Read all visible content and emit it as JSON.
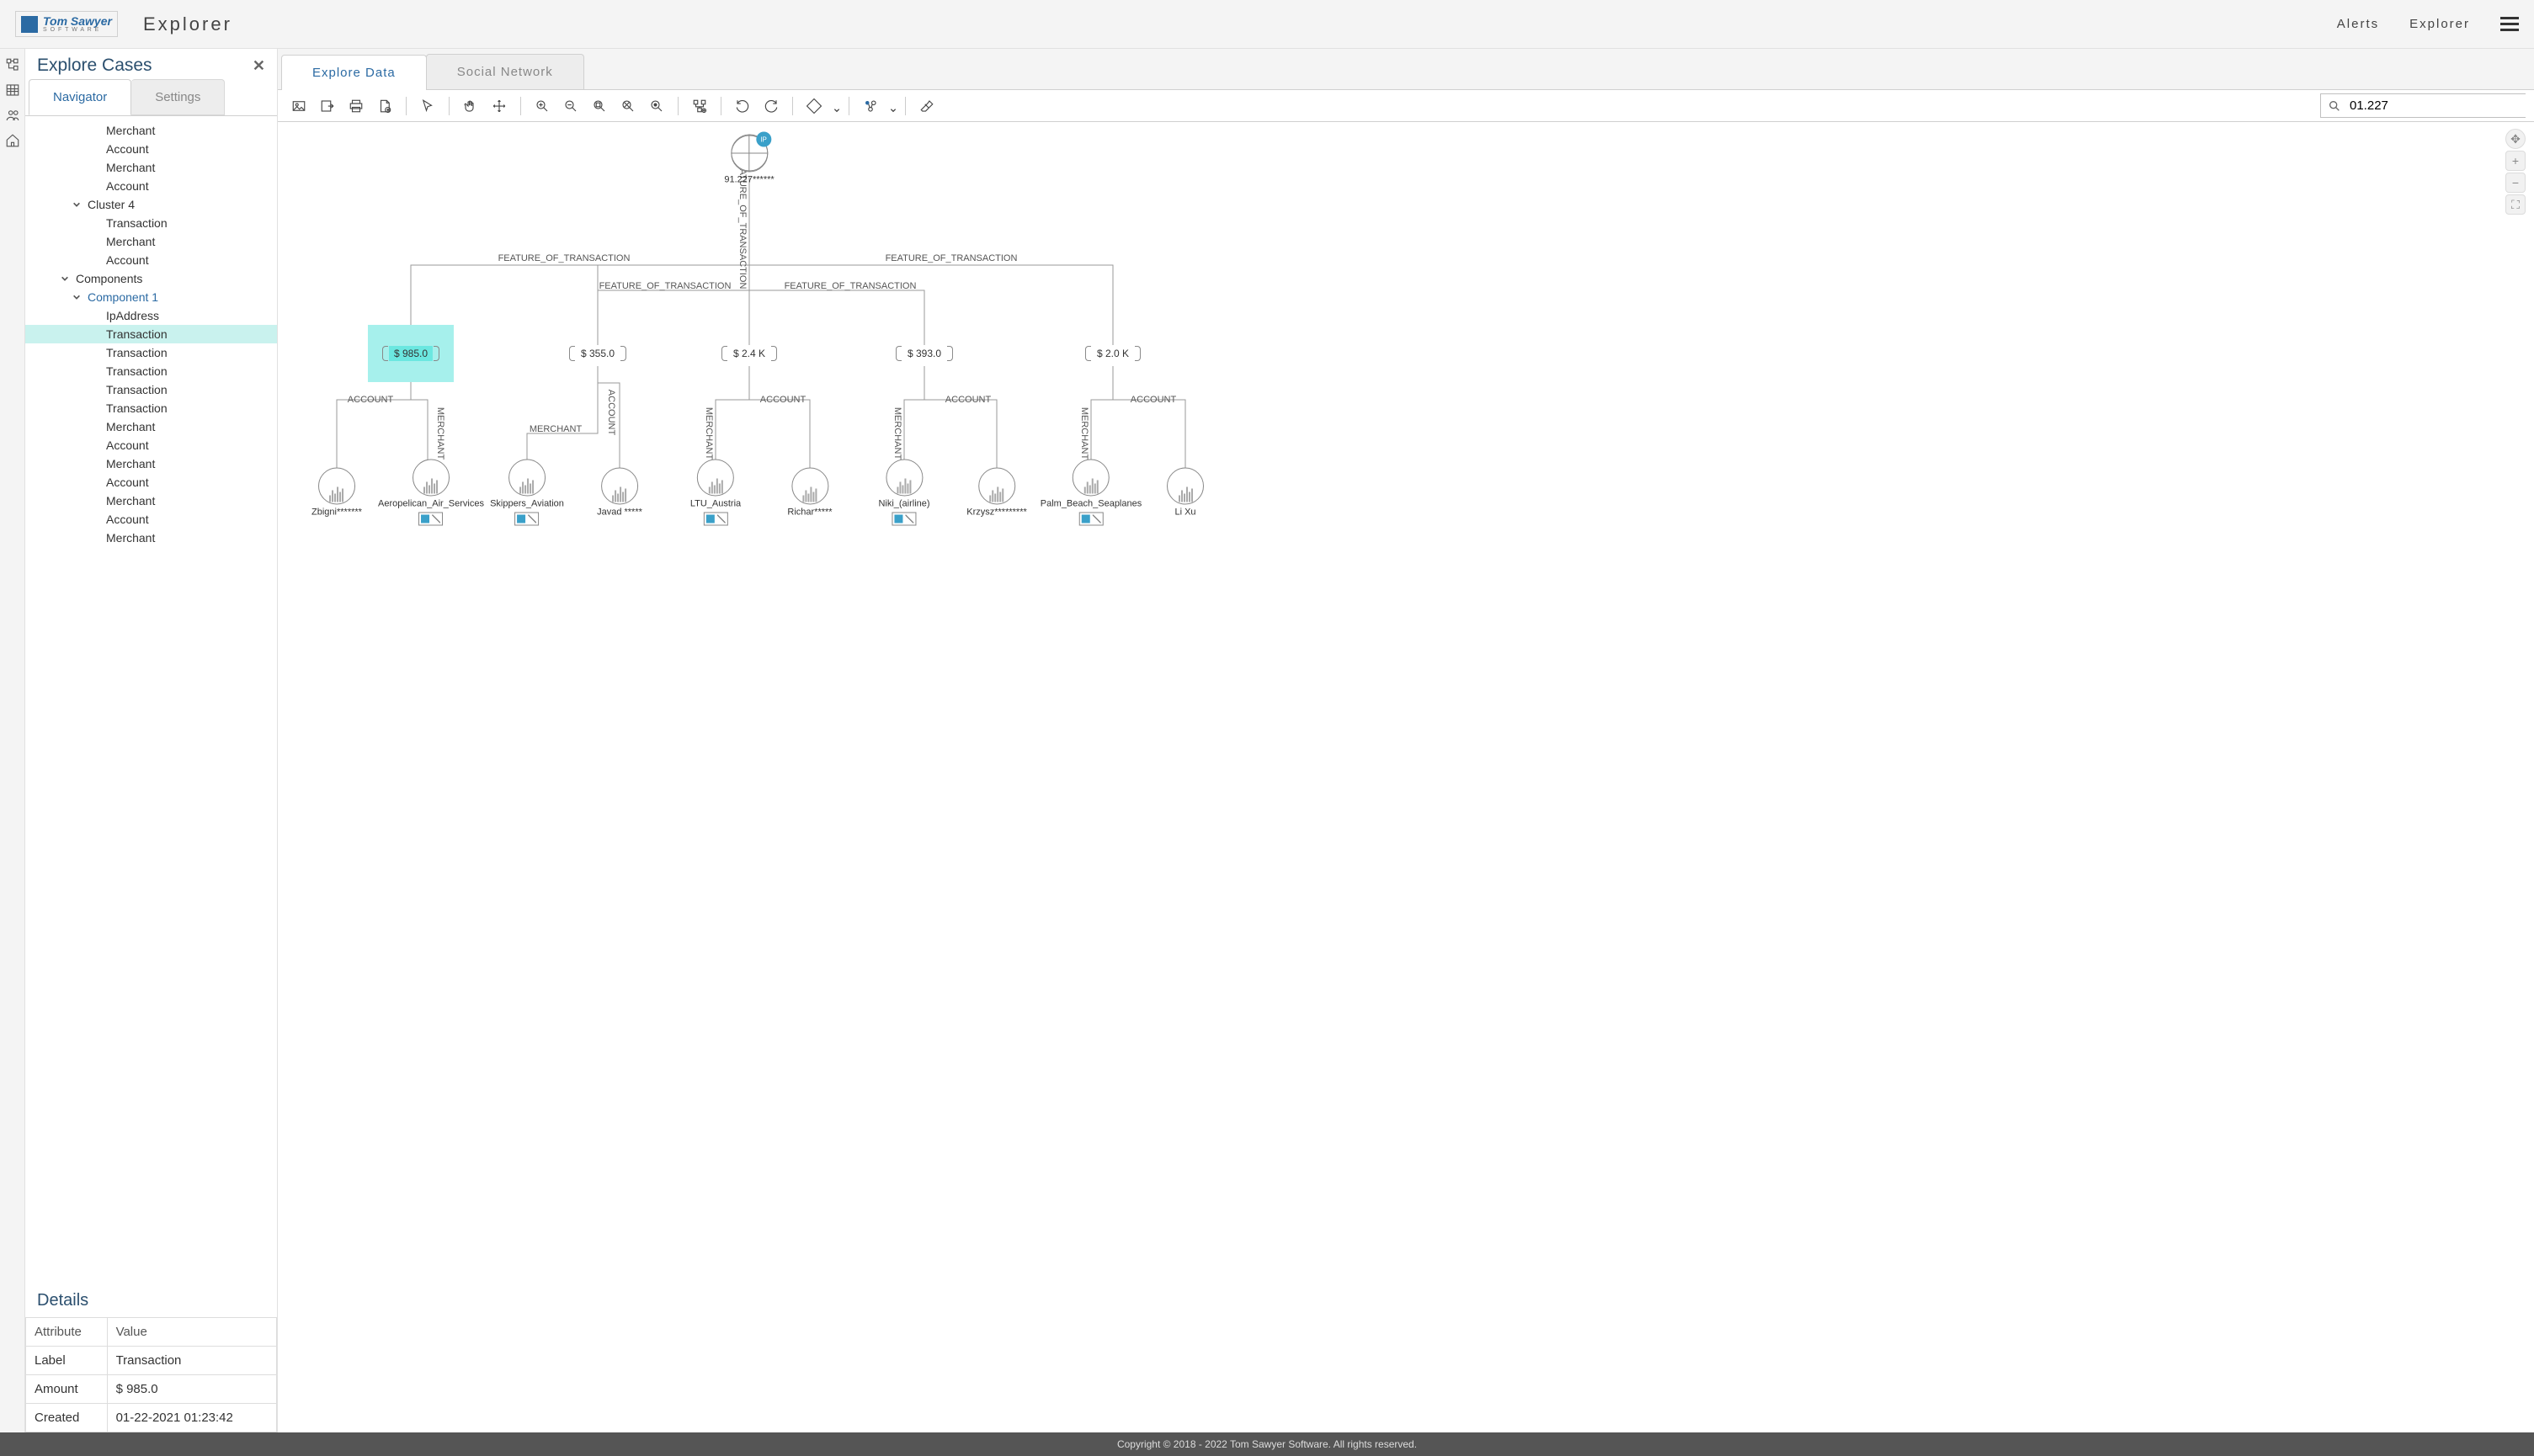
{
  "header": {
    "logo_top": "Tom Sawyer",
    "logo_bot": "S O F T W A R E",
    "app_title": "Explorer",
    "nav": {
      "alerts": "Alerts",
      "explorer": "Explorer"
    }
  },
  "sidebar": {
    "title": "Explore Cases",
    "subtabs": {
      "navigator": "Navigator",
      "settings": "Settings"
    },
    "tree": {
      "items3a": [
        "Merchant",
        "Account",
        "Merchant",
        "Account"
      ],
      "cluster4": "Cluster 4",
      "cluster4_children": [
        "Transaction",
        "Merchant",
        "Account"
      ],
      "components": "Components",
      "component1": "Component 1",
      "comp1_children": [
        "IpAddress",
        "Transaction",
        "Transaction",
        "Transaction",
        "Transaction",
        "Transaction",
        "Merchant",
        "Account",
        "Merchant",
        "Account",
        "Merchant",
        "Account",
        "Merchant"
      ]
    },
    "details_title": "Details",
    "details": {
      "c0": "Attribute",
      "c1": "Value",
      "r1a": "Label",
      "r1b": "Transaction",
      "r2a": "Amount",
      "r2b": "$ 985.0",
      "r3a": "Created",
      "r3b": "01-22-2021 01:23:42"
    }
  },
  "main": {
    "tabs": {
      "explore": "Explore Data",
      "social": "Social Network"
    },
    "search_value": "01.227"
  },
  "graph": {
    "ip": {
      "label": "91.227******"
    },
    "edge_feature": "FEATURE_OF_TRANSACTION",
    "edge_account": "ACCOUNT",
    "edge_merchant": "MERCHANT",
    "txn": {
      "t1": "$ 985.0",
      "t2": "$ 355.0",
      "t3": "$ 2.4 K",
      "t4": "$ 393.0",
      "t5": "$ 2.0 K"
    },
    "people": {
      "p1": "Zbigni*******",
      "p3": "Javad *****",
      "p5": "Richar*****",
      "p7": "Krzysz*********",
      "p9": "Li Xu"
    },
    "merchants": {
      "m1": "Aeropelican_Air_Services",
      "m2": "Skippers_Aviation",
      "m3": "LTU_Austria",
      "m4": "Niki_(airline)",
      "m5": "Palm_Beach_Seaplanes"
    }
  },
  "footer": "Copyright © 2018 - 2022 Tom Sawyer Software. All rights reserved."
}
